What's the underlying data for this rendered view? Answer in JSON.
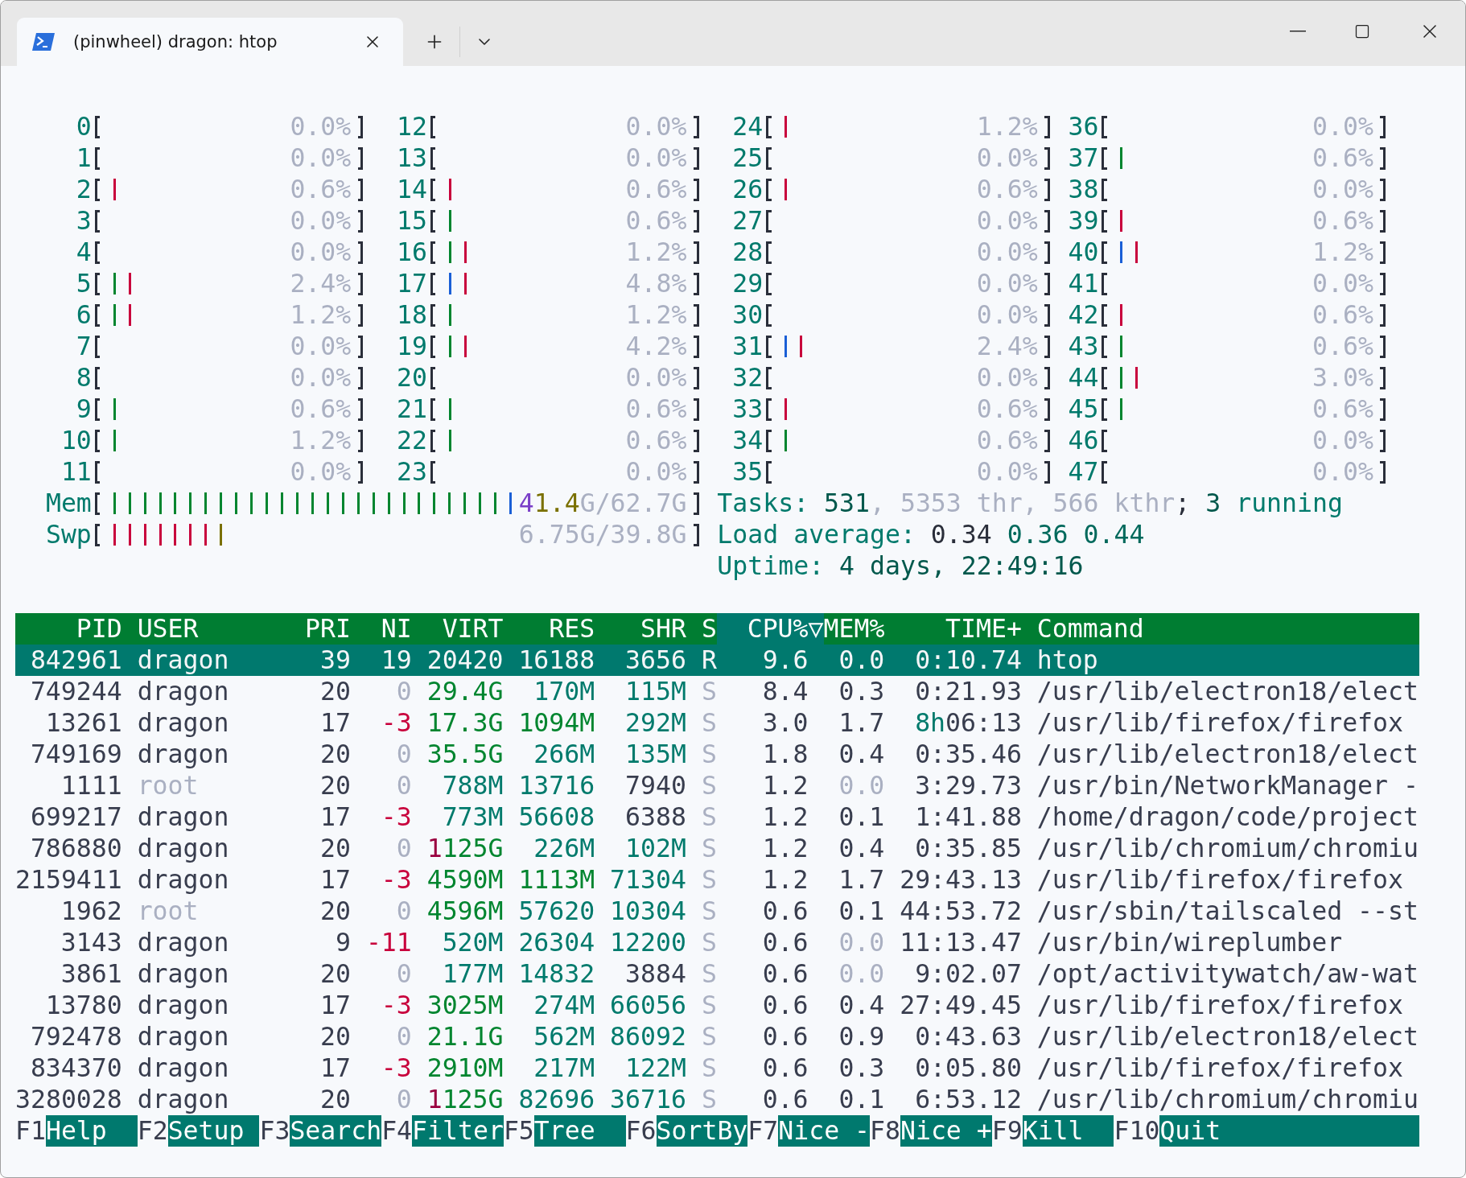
{
  "tab": {
    "title": "(pinwheel) dragon: htop"
  },
  "cpu_meters": [
    {
      "label": "0",
      "reading": "0.0%"
    },
    {
      "label": "1",
      "reading": "0.0%"
    },
    {
      "label": "2",
      "bars": [
        {
          "color": "#c8003c"
        }
      ],
      "reading": "0.6%"
    },
    {
      "label": "3",
      "reading": "0.0%"
    },
    {
      "label": "4",
      "reading": "0.0%"
    },
    {
      "label": "5",
      "bars": [
        {
          "color": "#00852f"
        },
        {
          "color": "#c8003c"
        }
      ],
      "reading": "2.4%"
    },
    {
      "label": "6",
      "bars": [
        {
          "color": "#00852f"
        },
        {
          "color": "#c8003c"
        }
      ],
      "reading": "1.2%"
    },
    {
      "label": "7",
      "reading": "0.0%"
    },
    {
      "label": "8",
      "reading": "0.0%"
    },
    {
      "label": "9",
      "bars": [
        {
          "color": "#00852f"
        }
      ],
      "reading": "0.6%"
    },
    {
      "label": "10",
      "bars": [
        {
          "color": "#00852f"
        }
      ],
      "reading": "1.2%"
    },
    {
      "label": "11",
      "reading": "0.0%"
    },
    {
      "label": "12",
      "reading": "0.0%"
    },
    {
      "label": "13",
      "reading": "0.0%"
    },
    {
      "label": "14",
      "bars": [
        {
          "color": "#c8003c"
        }
      ],
      "reading": "0.6%"
    },
    {
      "label": "15",
      "bars": [
        {
          "color": "#00852f"
        }
      ],
      "reading": "0.6%"
    },
    {
      "label": "16",
      "bars": [
        {
          "color": "#00852f"
        },
        {
          "color": "#c8003c"
        }
      ],
      "reading": "1.2%"
    },
    {
      "label": "17",
      "bars": [
        {
          "color": "#1a5fd6"
        },
        {
          "color": "#c8003c"
        }
      ],
      "reading": "4.8%"
    },
    {
      "label": "18",
      "bars": [
        {
          "color": "#00852f"
        }
      ],
      "reading": "1.2%"
    },
    {
      "label": "19",
      "bars": [
        {
          "color": "#00852f"
        },
        {
          "color": "#c8003c"
        }
      ],
      "reading": "4.2%"
    },
    {
      "label": "20",
      "reading": "0.0%"
    },
    {
      "label": "21",
      "bars": [
        {
          "color": "#00852f"
        }
      ],
      "reading": "0.6%"
    },
    {
      "label": "22",
      "bars": [
        {
          "color": "#00852f"
        }
      ],
      "reading": "0.6%"
    },
    {
      "label": "23",
      "reading": "0.0%"
    },
    {
      "label": "24",
      "bars": [
        {
          "color": "#c8003c"
        }
      ],
      "reading": "1.2%"
    },
    {
      "label": "25",
      "reading": "0.0%"
    },
    {
      "label": "26",
      "bars": [
        {
          "color": "#c8003c"
        }
      ],
      "reading": "0.6%"
    },
    {
      "label": "27",
      "reading": "0.0%"
    },
    {
      "label": "28",
      "reading": "0.0%"
    },
    {
      "label": "29",
      "reading": "0.0%"
    },
    {
      "label": "30",
      "reading": "0.0%"
    },
    {
      "label": "31",
      "bars": [
        {
          "color": "#1a5fd6"
        },
        {
          "color": "#c8003c"
        }
      ],
      "reading": "2.4%"
    },
    {
      "label": "32",
      "reading": "0.0%"
    },
    {
      "label": "33",
      "bars": [
        {
          "color": "#c8003c"
        }
      ],
      "reading": "0.6%"
    },
    {
      "label": "34",
      "bars": [
        {
          "color": "#00852f"
        }
      ],
      "reading": "0.6%"
    },
    {
      "label": "35",
      "reading": "0.0%"
    },
    {
      "label": "36",
      "reading": "0.0%"
    },
    {
      "label": "37",
      "bars": [
        {
          "color": "#00852f"
        }
      ],
      "reading": "0.6%"
    },
    {
      "label": "38",
      "reading": "0.0%"
    },
    {
      "label": "39",
      "bars": [
        {
          "color": "#c8003c"
        }
      ],
      "reading": "0.6%"
    },
    {
      "label": "40",
      "bars": [
        {
          "color": "#1a5fd6"
        },
        {
          "color": "#c8003c"
        }
      ],
      "reading": "1.2%"
    },
    {
      "label": "41",
      "reading": "0.0%"
    },
    {
      "label": "42",
      "bars": [
        {
          "color": "#c8003c"
        }
      ],
      "reading": "0.6%"
    },
    {
      "label": "43",
      "bars": [
        {
          "color": "#00852f"
        }
      ],
      "reading": "0.6%"
    },
    {
      "label": "44",
      "bars": [
        {
          "color": "#00852f"
        },
        {
          "color": "#c8003c"
        }
      ],
      "reading": "3.0%"
    },
    {
      "label": "45",
      "bars": [
        {
          "color": "#00852f"
        }
      ],
      "reading": "0.6%"
    },
    {
      "label": "46",
      "reading": "0.0%"
    },
    {
      "label": "47",
      "reading": "0.0%"
    }
  ],
  "memory_meters": [
    {
      "label": "Mem",
      "bars": [
        {
          "color": "#00852f"
        },
        {
          "color": "#00852f"
        },
        {
          "color": "#00852f"
        },
        {
          "color": "#00852f"
        },
        {
          "color": "#00852f"
        },
        {
          "color": "#00852f"
        },
        {
          "color": "#00852f"
        },
        {
          "color": "#00852f"
        },
        {
          "color": "#00852f"
        },
        {
          "color": "#00852f"
        },
        {
          "color": "#00852f"
        },
        {
          "color": "#00852f"
        },
        {
          "color": "#00852f"
        },
        {
          "color": "#00852f"
        },
        {
          "color": "#00852f"
        },
        {
          "color": "#00852f"
        },
        {
          "color": "#00852f"
        },
        {
          "color": "#00852f"
        },
        {
          "color": "#00852f"
        },
        {
          "color": "#00852f"
        },
        {
          "color": "#00852f"
        },
        {
          "color": "#00852f"
        },
        {
          "color": "#00852f"
        },
        {
          "color": "#00852f"
        },
        {
          "color": "#00852f"
        },
        {
          "color": "#00852f"
        },
        {
          "color": "#1a5fd6"
        }
      ],
      "reading": [
        {
          "text": "4",
          "color": "#7a3fc8"
        },
        {
          "text": "1.4",
          "color": "#7a7000"
        },
        {
          "text": "G/62.7G",
          "color": "#aab0c2"
        }
      ]
    },
    {
      "label": "Swp",
      "bars": [
        {
          "color": "#c8003c"
        },
        {
          "color": "#c8003c"
        },
        {
          "color": "#c8003c"
        },
        {
          "color": "#c8003c"
        },
        {
          "color": "#c8003c"
        },
        {
          "color": "#c8003c"
        },
        {
          "color": "#c8003c"
        },
        {
          "color": "#7a7000"
        }
      ],
      "reading": [
        {
          "text": "6.75G/39.8G",
          "color": "#aab0c2"
        }
      ]
    }
  ],
  "summary": [
    [
      {
        "text": "Tasks: ",
        "color": "#007a6c"
      },
      {
        "text": "531",
        "color": "#00584c"
      },
      {
        "text": ", 5353 thr, 566 kthr",
        "color": "#aab0c2"
      },
      {
        "text": "; ",
        "color": "#2a2e3a"
      },
      {
        "text": "3",
        "color": "#00584c"
      },
      {
        "text": " running",
        "color": "#007a6c"
      }
    ],
    [
      {
        "text": "Load average: ",
        "color": "#007a6c"
      },
      {
        "text": "0.34 ",
        "color": "#2a2e3a"
      },
      {
        "text": "0.36 0.44",
        "color": "#00695c"
      }
    ],
    [
      {
        "text": "Uptime: ",
        "color": "#007a6c"
      },
      {
        "text": "4 days, 22:49:16",
        "color": "#00584c"
      }
    ]
  ],
  "table": {
    "columns": [
      {
        "label": "PID",
        "selected": false
      },
      {
        "label": "USER",
        "selected": false
      },
      {
        "label": "PRI",
        "selected": false
      },
      {
        "label": "NI",
        "selected": false
      },
      {
        "label": "VIRT",
        "selected": false
      },
      {
        "label": "RES",
        "selected": false
      },
      {
        "label": "SHR",
        "selected": false
      },
      {
        "label": "S",
        "selected": false
      },
      {
        "label": "CPU%▽",
        "selected": true
      },
      {
        "label": "MEM%",
        "selected": false
      },
      {
        "label": "TIME+",
        "selected": false
      },
      {
        "label": "Command",
        "selected": false
      }
    ],
    "rows": [
      {
        "selected": true,
        "cells": [
          "842961",
          "dragon",
          "39",
          "19",
          "20420",
          "16188",
          "3656",
          "R",
          "9.6",
          "0.0",
          "0:10.74",
          "htop"
        ]
      },
      {
        "selected": false,
        "cells": [
          "749244",
          "dragon",
          "20",
          [
            {
              "text": "0",
              "color": "#aab0c2"
            }
          ],
          [
            {
              "text": "29.4G",
              "color": "#00852f"
            }
          ],
          [
            {
              "text": "170M",
              "color": "#007a6c"
            }
          ],
          [
            {
              "text": "115M",
              "color": "#007a6c"
            }
          ],
          [
            {
              "text": "S",
              "color": "#aab0c2"
            }
          ],
          "8.4",
          "0.3",
          "0:21.93",
          "/usr/lib/electron18/elect"
        ]
      },
      {
        "selected": false,
        "cells": [
          "13261",
          "dragon",
          "17",
          [
            {
              "text": "-3",
              "color": "#c8003c"
            }
          ],
          [
            {
              "text": "17.3G",
              "color": "#00852f"
            }
          ],
          [
            {
              "text": "1094M",
              "color": "#00852f"
            }
          ],
          [
            {
              "text": "292M",
              "color": "#007a6c"
            }
          ],
          [
            {
              "text": "S",
              "color": "#aab0c2"
            }
          ],
          "3.0",
          "1.7",
          [
            {
              "text": "8h",
              "color": "#007a6c"
            },
            {
              "text": "06:13",
              "color": "#383d4e"
            }
          ],
          "/usr/lib/firefox/firefox"
        ]
      },
      {
        "selected": false,
        "cells": [
          "749169",
          "dragon",
          "20",
          [
            {
              "text": "0",
              "color": "#aab0c2"
            }
          ],
          [
            {
              "text": "35.5G",
              "color": "#00852f"
            }
          ],
          [
            {
              "text": "266M",
              "color": "#007a6c"
            }
          ],
          [
            {
              "text": "135M",
              "color": "#007a6c"
            }
          ],
          [
            {
              "text": "S",
              "color": "#aab0c2"
            }
          ],
          "1.8",
          "0.4",
          "0:35.46",
          "/usr/lib/electron18/elect"
        ]
      },
      {
        "selected": false,
        "cells": [
          "1111",
          [
            {
              "text": "root",
              "color": "#aab0c2"
            }
          ],
          "20",
          [
            {
              "text": "0",
              "color": "#aab0c2"
            }
          ],
          [
            {
              "text": "788M",
              "color": "#007a6c"
            }
          ],
          [
            {
              "text": "13716",
              "color": "#007a6c"
            }
          ],
          "7940",
          [
            {
              "text": "S",
              "color": "#aab0c2"
            }
          ],
          "1.2",
          [
            {
              "text": "0.0",
              "color": "#aab0c2"
            }
          ],
          "3:29.73",
          "/usr/bin/NetworkManager -"
        ]
      },
      {
        "selected": false,
        "cells": [
          "699217",
          "dragon",
          "17",
          [
            {
              "text": "-3",
              "color": "#c8003c"
            }
          ],
          [
            {
              "text": "773M",
              "color": "#007a6c"
            }
          ],
          [
            {
              "text": "56608",
              "color": "#007a6c"
            }
          ],
          "6388",
          [
            {
              "text": "S",
              "color": "#aab0c2"
            }
          ],
          "1.2",
          "0.1",
          "1:41.88",
          "/home/dragon/code/project"
        ]
      },
      {
        "selected": false,
        "cells": [
          "786880",
          "dragon",
          "20",
          [
            {
              "text": "0",
              "color": "#aab0c2"
            }
          ],
          [
            {
              "text": "1",
              "color": "#9a0040"
            },
            {
              "text": "125G",
              "color": "#00852f"
            }
          ],
          [
            {
              "text": "226M",
              "color": "#007a6c"
            }
          ],
          [
            {
              "text": "102M",
              "color": "#007a6c"
            }
          ],
          [
            {
              "text": "S",
              "color": "#aab0c2"
            }
          ],
          "1.2",
          "0.4",
          "0:35.85",
          "/usr/lib/chromium/chromiu"
        ]
      },
      {
        "selected": false,
        "cells": [
          "2159411",
          "dragon",
          "17",
          [
            {
              "text": "-3",
              "color": "#c8003c"
            }
          ],
          [
            {
              "text": "4590M",
              "color": "#00852f"
            }
          ],
          [
            {
              "text": "1113M",
              "color": "#00852f"
            }
          ],
          [
            {
              "text": "71304",
              "color": "#007a6c"
            }
          ],
          [
            {
              "text": "S",
              "color": "#aab0c2"
            }
          ],
          "1.2",
          "1.7",
          "29:43.13",
          "/usr/lib/firefox/firefox"
        ]
      },
      {
        "selected": false,
        "cells": [
          "1962",
          [
            {
              "text": "root",
              "color": "#aab0c2"
            }
          ],
          "20",
          [
            {
              "text": "0",
              "color": "#aab0c2"
            }
          ],
          [
            {
              "text": "4596M",
              "color": "#00852f"
            }
          ],
          [
            {
              "text": "57620",
              "color": "#007a6c"
            }
          ],
          [
            {
              "text": "10304",
              "color": "#007a6c"
            }
          ],
          [
            {
              "text": "S",
              "color": "#aab0c2"
            }
          ],
          "0.6",
          "0.1",
          "44:53.72",
          "/usr/sbin/tailscaled --st"
        ]
      },
      {
        "selected": false,
        "cells": [
          "3143",
          "dragon",
          "9",
          [
            {
              "text": "-11",
              "color": "#c8003c"
            }
          ],
          [
            {
              "text": "520M",
              "color": "#007a6c"
            }
          ],
          [
            {
              "text": "26304",
              "color": "#007a6c"
            }
          ],
          [
            {
              "text": "12200",
              "color": "#007a6c"
            }
          ],
          [
            {
              "text": "S",
              "color": "#aab0c2"
            }
          ],
          "0.6",
          [
            {
              "text": "0.0",
              "color": "#aab0c2"
            }
          ],
          "11:13.47",
          "/usr/bin/wireplumber"
        ]
      },
      {
        "selected": false,
        "cells": [
          "3861",
          "dragon",
          "20",
          [
            {
              "text": "0",
              "color": "#aab0c2"
            }
          ],
          [
            {
              "text": "177M",
              "color": "#007a6c"
            }
          ],
          [
            {
              "text": "14832",
              "color": "#007a6c"
            }
          ],
          "3884",
          [
            {
              "text": "S",
              "color": "#aab0c2"
            }
          ],
          "0.6",
          [
            {
              "text": "0.0",
              "color": "#aab0c2"
            }
          ],
          "9:02.07",
          "/opt/activitywatch/aw-wat"
        ]
      },
      {
        "selected": false,
        "cells": [
          "13780",
          "dragon",
          "17",
          [
            {
              "text": "-3",
              "color": "#c8003c"
            }
          ],
          [
            {
              "text": "3025M",
              "color": "#00852f"
            }
          ],
          [
            {
              "text": "274M",
              "color": "#007a6c"
            }
          ],
          [
            {
              "text": "66056",
              "color": "#007a6c"
            }
          ],
          [
            {
              "text": "S",
              "color": "#aab0c2"
            }
          ],
          "0.6",
          "0.4",
          "27:49.45",
          "/usr/lib/firefox/firefox"
        ]
      },
      {
        "selected": false,
        "cells": [
          "792478",
          "dragon",
          "20",
          [
            {
              "text": "0",
              "color": "#aab0c2"
            }
          ],
          [
            {
              "text": "21.1G",
              "color": "#00852f"
            }
          ],
          [
            {
              "text": "562M",
              "color": "#007a6c"
            }
          ],
          [
            {
              "text": "86092",
              "color": "#007a6c"
            }
          ],
          [
            {
              "text": "S",
              "color": "#aab0c2"
            }
          ],
          "0.6",
          "0.9",
          "0:43.63",
          "/usr/lib/electron18/elect"
        ]
      },
      {
        "selected": false,
        "cells": [
          "834370",
          "dragon",
          "17",
          [
            {
              "text": "-3",
              "color": "#c8003c"
            }
          ],
          [
            {
              "text": "2910M",
              "color": "#00852f"
            }
          ],
          [
            {
              "text": "217M",
              "color": "#007a6c"
            }
          ],
          [
            {
              "text": "122M",
              "color": "#007a6c"
            }
          ],
          [
            {
              "text": "S",
              "color": "#aab0c2"
            }
          ],
          "0.6",
          "0.3",
          "0:05.80",
          "/usr/lib/firefox/firefox"
        ]
      },
      {
        "selected": false,
        "cells": [
          "3280028",
          "dragon",
          "20",
          [
            {
              "text": "0",
              "color": "#aab0c2"
            }
          ],
          [
            {
              "text": "1",
              "color": "#9a0040"
            },
            {
              "text": "125G",
              "color": "#00852f"
            }
          ],
          [
            {
              "text": "82696",
              "color": "#007a6c"
            }
          ],
          [
            {
              "text": "36716",
              "color": "#007a6c"
            }
          ],
          [
            {
              "text": "S",
              "color": "#aab0c2"
            }
          ],
          "0.6",
          "0.1",
          "6:53.12",
          "/usr/lib/chromium/chromiu"
        ]
      }
    ]
  },
  "function_keys": [
    {
      "key": "F1",
      "label": "Help"
    },
    {
      "key": "F2",
      "label": "Setup"
    },
    {
      "key": "F3",
      "label": "Search"
    },
    {
      "key": "F4",
      "label": "Filter"
    },
    {
      "key": "F5",
      "label": "Tree"
    },
    {
      "key": "F6",
      "label": "SortBy"
    },
    {
      "key": "F7",
      "label": "Nice -"
    },
    {
      "key": "F8",
      "label": "Nice +"
    },
    {
      "key": "F9",
      "label": "Kill"
    },
    {
      "key": "F10",
      "label": "Quit"
    }
  ]
}
